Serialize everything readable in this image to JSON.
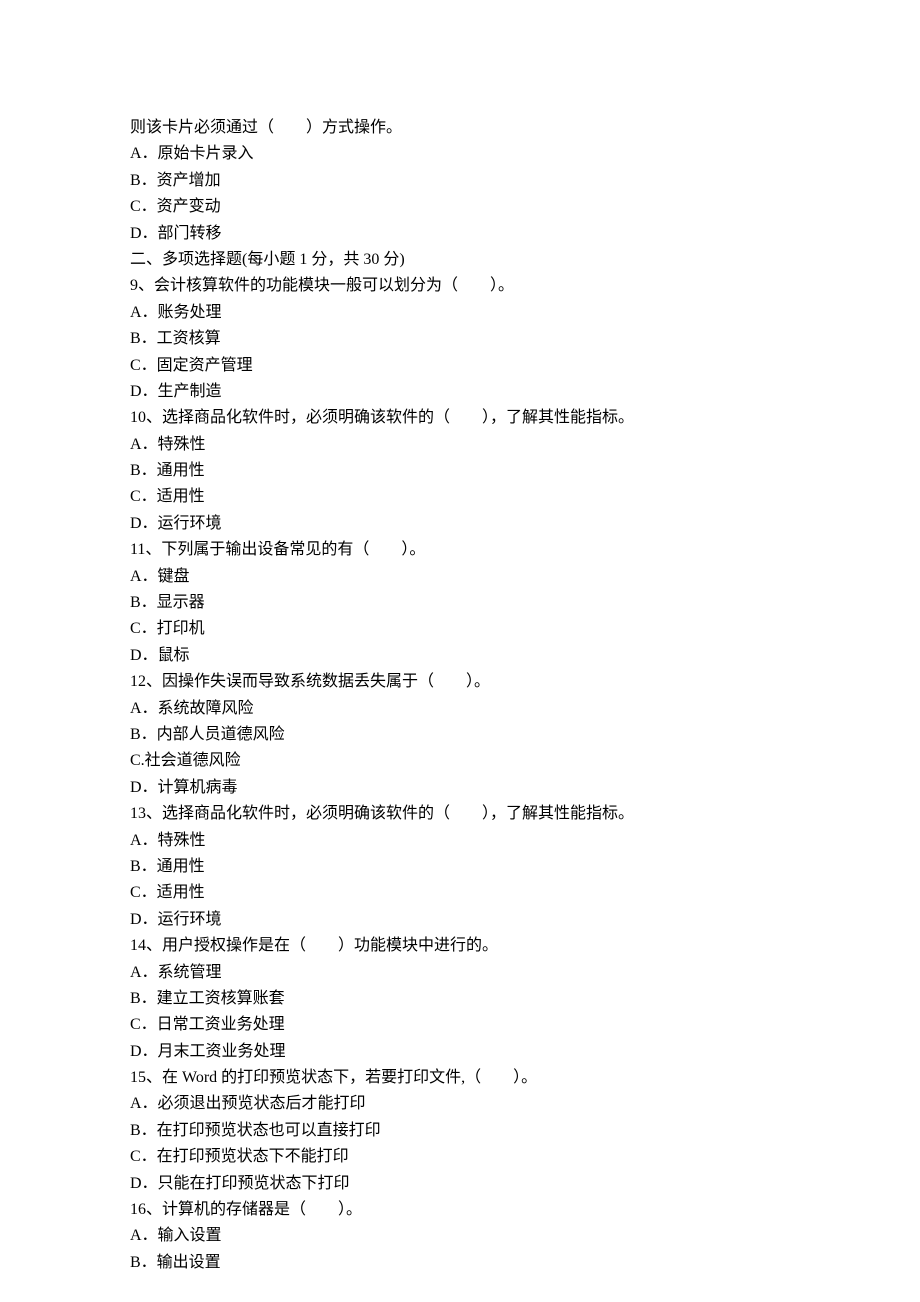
{
  "lines": [
    "则该卡片必须通过（　　）方式操作。",
    "A．原始卡片录入",
    "B．资产增加",
    "C．资产变动",
    "D．部门转移",
    "二、多项选择题(每小题 1 分，共 30 分)",
    "9、会计核算软件的功能模块一般可以划分为（　　）。",
    "A．账务处理",
    "B．工资核算",
    "C．固定资产管理",
    "D．生产制造",
    "10、选择商品化软件时，必须明确该软件的（　　），了解其性能指标。",
    "A．特殊性",
    "B．通用性",
    "C．适用性",
    "D．运行环境",
    "11、下列属于输出设备常见的有（　　）。",
    "A．键盘",
    "B．显示器",
    "C．打印机",
    "D．鼠标",
    "12、因操作失误而导致系统数据丢失属于（　　）。",
    "A．系统故障风险",
    "B．内部人员道德风险",
    "C.社会道德风险",
    "D．计算机病毒",
    "13、选择商品化软件时，必须明确该软件的（　　），了解其性能指标。",
    "A．特殊性",
    "B．通用性",
    "C．适用性",
    "D．运行环境",
    "14、用户授权操作是在（　　）功能模块中进行的。",
    "A．系统管理",
    "B．建立工资核算账套",
    "C．日常工资业务处理",
    "D．月末工资业务处理",
    "15、在 Word 的打印预览状态下，若要打印文件,（　　）。",
    "A．必须退出预览状态后才能打印",
    "B．在打印预览状态也可以直接打印",
    "C．在打印预览状态下不能打印",
    "D．只能在打印预览状态下打印",
    "16、计算机的存储器是（　　）。",
    "A．输入设置",
    "B．输出设置"
  ]
}
